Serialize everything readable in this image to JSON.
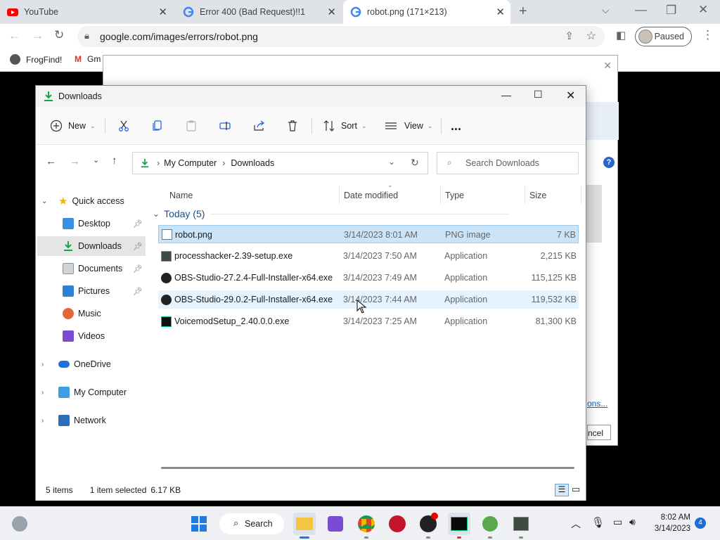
{
  "browser": {
    "tabs": [
      {
        "title": "YouTube",
        "favicon": "youtube-icon"
      },
      {
        "title": "Error 400 (Bad Request)!!1",
        "favicon": "google-icon"
      },
      {
        "title": "robot.png (171×213)",
        "favicon": "google-icon"
      }
    ],
    "url": "google.com/images/errors/robot.png",
    "profile_label": "Paused",
    "bookmarks": [
      {
        "label": "FrogFind!"
      },
      {
        "label": "Gm"
      }
    ]
  },
  "explorer": {
    "title": "Downloads",
    "toolbar": {
      "new_label": "New",
      "sort_label": "Sort",
      "view_label": "View",
      "more_label": "..."
    },
    "breadcrumb": [
      "My Computer",
      "Downloads"
    ],
    "search_placeholder": "Search Downloads",
    "nav": [
      {
        "label": "Quick access",
        "icon": "star-icon"
      },
      {
        "label": "Desktop",
        "icon": "desktop-icon",
        "pinned": true
      },
      {
        "label": "Downloads",
        "icon": "download-icon",
        "pinned": true,
        "selected": true
      },
      {
        "label": "Documents",
        "icon": "documents-icon",
        "pinned": true
      },
      {
        "label": "Pictures",
        "icon": "pictures-icon",
        "pinned": true
      },
      {
        "label": "Music",
        "icon": "music-icon"
      },
      {
        "label": "Videos",
        "icon": "videos-icon"
      },
      {
        "label": "OneDrive",
        "icon": "cloud-icon"
      },
      {
        "label": "My Computer",
        "icon": "computer-icon"
      },
      {
        "label": "Network",
        "icon": "network-icon"
      }
    ],
    "columns": [
      "Name",
      "Date modified",
      "Type",
      "Size"
    ],
    "group_label": "Today (5)",
    "files": [
      {
        "name": "robot.png",
        "date": "3/14/2023 8:01 AM",
        "type": "PNG image",
        "size": "7 KB"
      },
      {
        "name": "processhacker-2.39-setup.exe",
        "date": "3/14/2023 7:50 AM",
        "type": "Application",
        "size": "2,215 KB"
      },
      {
        "name": "OBS-Studio-27.2.4-Full-Installer-x64.exe",
        "date": "3/14/2023 7:49 AM",
        "type": "Application",
        "size": "115,125 KB"
      },
      {
        "name": "OBS-Studio-29.0.2-Full-Installer-x64.exe",
        "date": "3/14/2023 7:44 AM",
        "type": "Application",
        "size": "119,532 KB"
      },
      {
        "name": "VoicemodSetup_2.40.0.0.exe",
        "date": "3/14/2023 7:25 AM",
        "type": "Application",
        "size": "81,300 KB"
      }
    ],
    "status": {
      "count": "5 items",
      "selected": "1 item selected",
      "size": "6.17 KB"
    }
  },
  "background_dialog": {
    "link_text": "ons...",
    "cancel_label": "ncel"
  },
  "taskbar": {
    "search_label": "Search",
    "time": "8:02 AM",
    "date": "3/14/2023",
    "notification_count": "4"
  }
}
